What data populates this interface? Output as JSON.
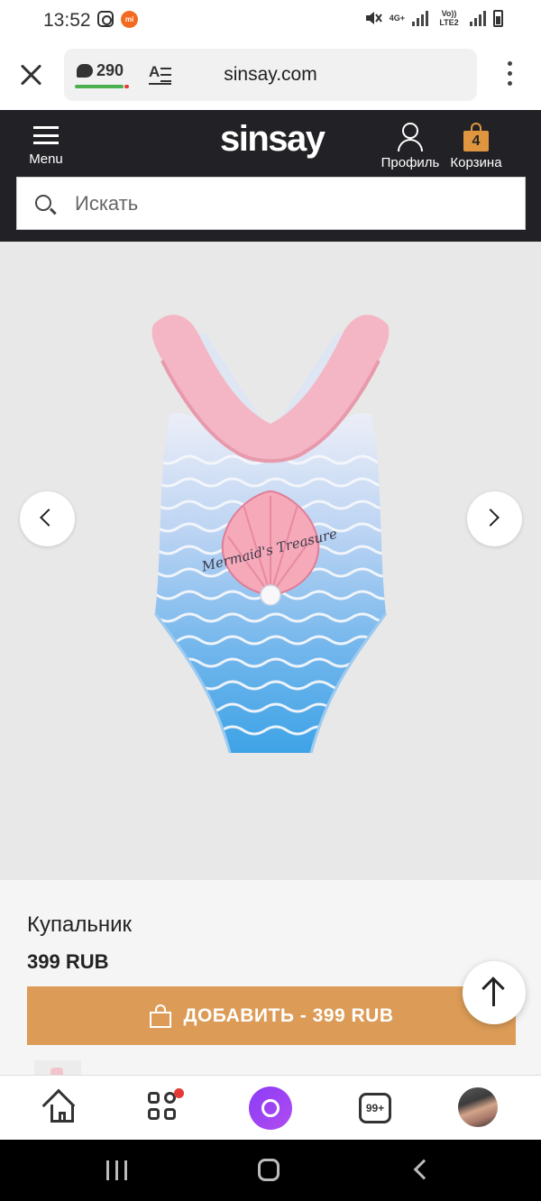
{
  "status_bar": {
    "time": "13:52",
    "network_label": "4G+",
    "volte_label": "Vo)) LTE2"
  },
  "browser": {
    "url": "sinsay.com",
    "comments_count": "290"
  },
  "header": {
    "logo": "sinsay",
    "menu_label": "Menu",
    "profile_label": "Профиль",
    "cart_label": "Корзина",
    "cart_count": "4",
    "search_placeholder": "Искать"
  },
  "product": {
    "name": "Купальник",
    "price": "399 RUB",
    "add_button_label": "ДОБАВИТЬ - 399 RUB",
    "print_text": "Mermaid's Treasure"
  },
  "bottom_nav": {
    "tabs_count": "99+"
  },
  "colors": {
    "header_bg": "#222226",
    "accent": "#dc9c57",
    "cart_badge": "#e0963e",
    "alice_purple": "#8a3cf7"
  },
  "icons": [
    "close-icon",
    "comment-icon",
    "reader-mode-icon",
    "more-vert-icon",
    "menu-icon",
    "profile-icon",
    "cart-icon",
    "search-icon",
    "chevron-left-icon",
    "chevron-right-icon",
    "bag-icon",
    "arrow-up-icon",
    "home-icon",
    "apps-icon",
    "alice-icon",
    "tabs-icon"
  ]
}
